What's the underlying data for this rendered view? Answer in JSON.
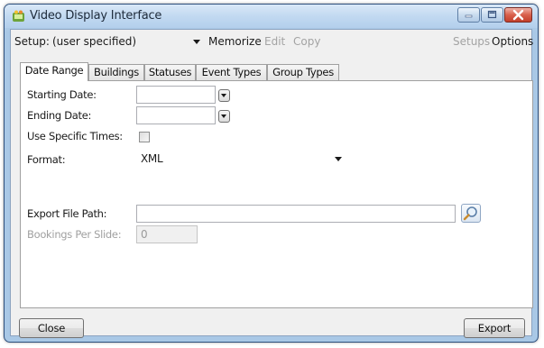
{
  "window": {
    "title": "Video Display Interface",
    "icon": "app-logo-icon",
    "controls": [
      "minimize-icon",
      "maximize-icon",
      "close-icon"
    ]
  },
  "toolbar": {
    "setup_label": "Setup:",
    "setup_value": "(user specified)",
    "memorize": "Memorize",
    "edit": "Edit",
    "copy": "Copy",
    "setups": "Setups",
    "options": "Options"
  },
  "tabs": [
    {
      "label": "Date Range",
      "active": true
    },
    {
      "label": "Buildings",
      "active": false
    },
    {
      "label": "Statuses",
      "active": false
    },
    {
      "label": "Event Types",
      "active": false
    },
    {
      "label": "Group Types",
      "active": false
    }
  ],
  "form": {
    "starting_date_label": "Starting Date:",
    "starting_date_value": "",
    "ending_date_label": "Ending Date:",
    "ending_date_value": "",
    "use_specific_times_label": "Use Specific Times:",
    "use_specific_times_checked": false,
    "format_label": "Format:",
    "format_value": "XML",
    "export_path_label": "Export File Path:",
    "export_path_value": "",
    "bookings_per_slide_label": "Bookings Per Slide:",
    "bookings_per_slide_value": "0"
  },
  "footer": {
    "close": "Close",
    "export": "Export"
  },
  "colors": {
    "frame": "#a9c8e6",
    "client_bg": "#f0f0f0",
    "disabled_text": "#a3a3a3",
    "close_button": "#c23f2b"
  }
}
